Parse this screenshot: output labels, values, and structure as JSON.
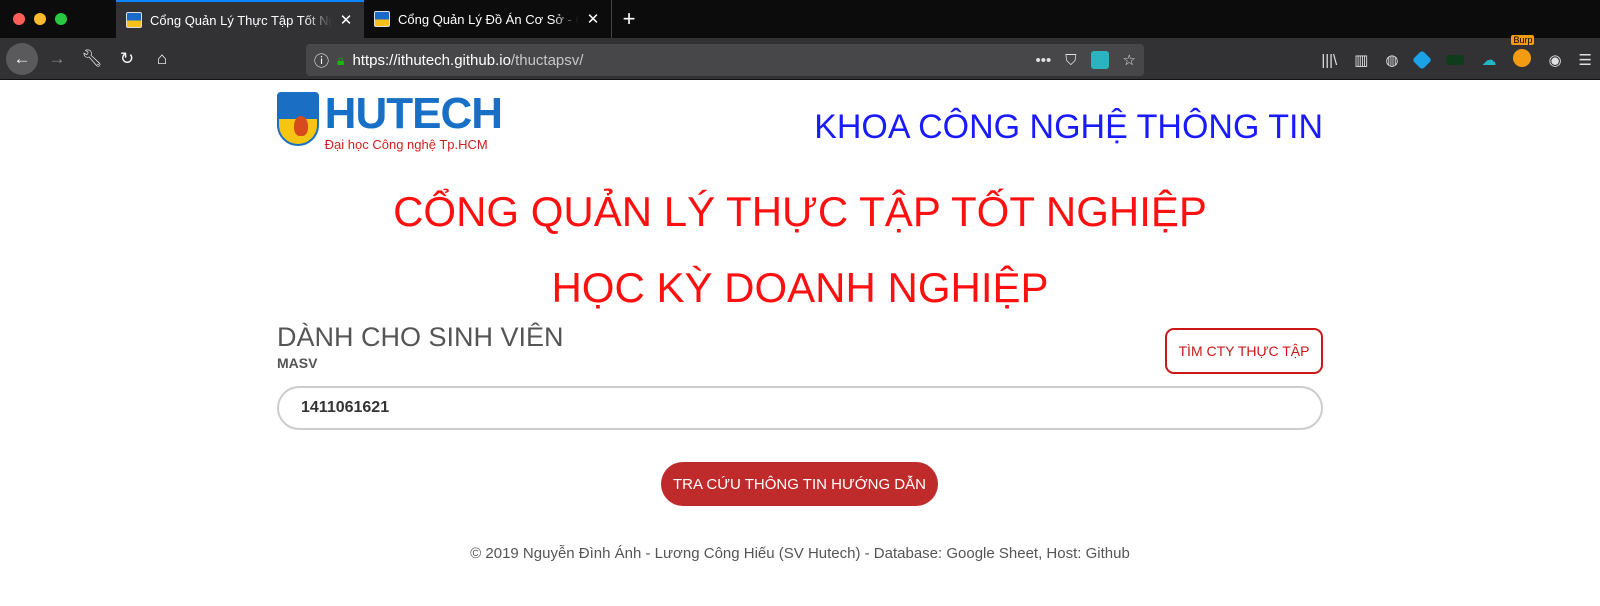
{
  "browser": {
    "tabs": [
      {
        "title": "Cổng Quản Lý Thực Tập Tốt Nghiệp",
        "active": true
      },
      {
        "title": "Cổng Quản Lý Đồ Án Cơ Sở - Cli",
        "active": false
      }
    ],
    "new_tab": "+",
    "url_host": "https://ithutech.github.io",
    "url_path": "/thuctapsv/",
    "url_actions": "•••",
    "burp_label": "Burp"
  },
  "header": {
    "logo_name": "HUTECH",
    "logo_tagline": "Đại học Công nghệ Tp.HCM",
    "faculty": "KHOA CÔNG NGHỆ THÔNG TIN"
  },
  "main": {
    "title_line1": "CỔNG QUẢN LÝ THỰC TẬP TỐT NGHIỆP",
    "title_line2": "HỌC KỲ DOANH NGHIỆP",
    "student_section": "DÀNH CHO SINH VIÊN",
    "masv_label": "MASV",
    "masv_value": "1411061621",
    "find_company_button": "TÌM CTY THỰC TẬP",
    "lookup_button": "TRA CỨU THÔNG TIN HƯỚNG DẪN"
  },
  "footer": {
    "text": "© 2019 Nguyễn Đình Ánh - Lương Công Hiếu (SV Hutech) - Database: Google Sheet, Host: Github"
  },
  "colors": {
    "title_red": "#ff1010",
    "faculty_blue": "#1a1aff",
    "button_red": "#bf2a2a"
  }
}
